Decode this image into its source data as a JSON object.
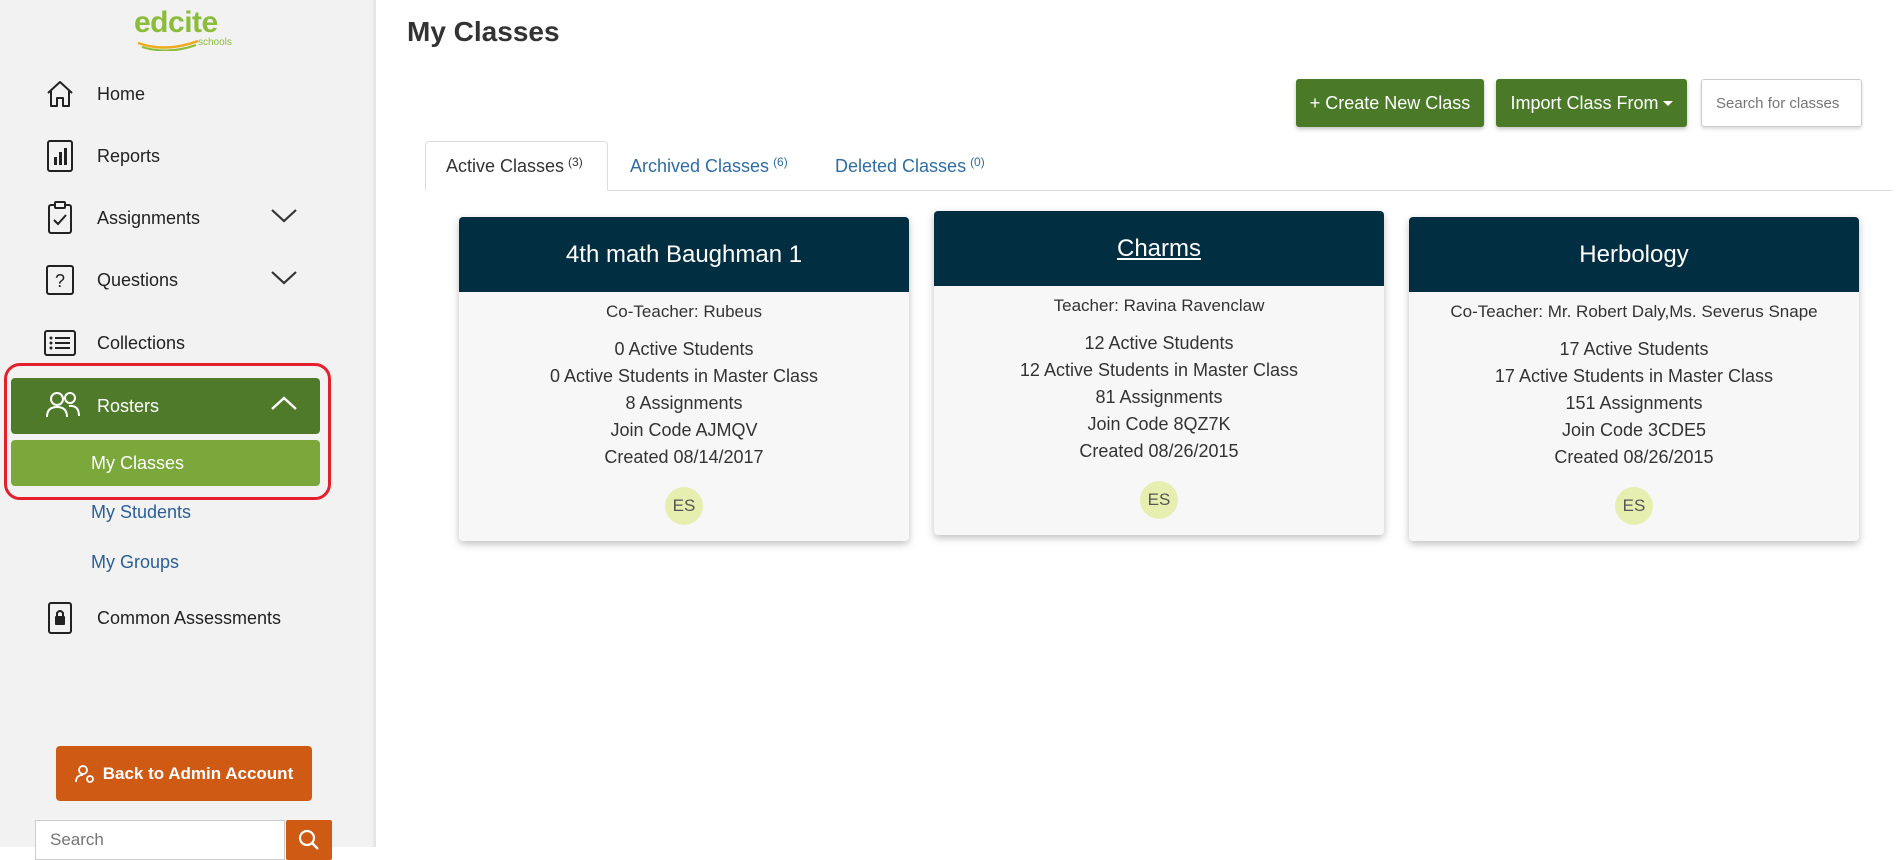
{
  "logo": {
    "word": "edcite",
    "sub": "schools"
  },
  "sidebar": {
    "items": [
      {
        "label": "Home"
      },
      {
        "label": "Reports"
      },
      {
        "label": "Assignments"
      },
      {
        "label": "Questions"
      },
      {
        "label": "Collections"
      },
      {
        "label": "Rosters"
      },
      {
        "label": "Common Assessments"
      }
    ],
    "subitems": [
      {
        "label": "My Classes"
      },
      {
        "label": "My Students"
      },
      {
        "label": "My Groups"
      }
    ],
    "admin_button": "Back to Admin Account",
    "search_placeholder": "Search"
  },
  "header": {
    "title": "My Classes",
    "create_button": "+ Create New Class",
    "import_button": "Import Class From",
    "search_placeholder": "Search for classes"
  },
  "tabs": [
    {
      "label": "Active Classes",
      "count": "(3)"
    },
    {
      "label": "Archived Classes",
      "count": "(6)"
    },
    {
      "label": "Deleted Classes",
      "count": "(0)"
    }
  ],
  "classes": [
    {
      "name": "4th math Baughman 1",
      "teacher": "Co-Teacher: Rubeus",
      "active_students": "0 Active Students",
      "master_students": "0 Active Students in Master Class",
      "assignments": "8 Assignments",
      "join_code": "Join Code AJMQV",
      "created": "Created 08/14/2017",
      "avatar": "ES"
    },
    {
      "name": "Charms",
      "teacher": "Teacher: Ravina Ravenclaw",
      "active_students": "12 Active Students",
      "master_students": "12 Active Students in Master Class",
      "assignments": "81 Assignments",
      "join_code": "Join Code 8QZ7K",
      "created": "Created 08/26/2015",
      "avatar": "ES"
    },
    {
      "name": "Herbology",
      "teacher": "Co-Teacher: Mr. Robert Daly,Ms. Severus Snape",
      "active_students": "17 Active Students",
      "master_students": "17 Active Students in Master Class",
      "assignments": "151 Assignments",
      "join_code": "Join Code 3CDE5",
      "created": "Created 08/26/2015",
      "avatar": "ES"
    }
  ],
  "colors": {
    "accent_green": "#4a7a28",
    "light_green": "#7ba83a",
    "card_header": "#022e41",
    "orange": "#cf5a14",
    "highlight_red": "#e3202b"
  }
}
